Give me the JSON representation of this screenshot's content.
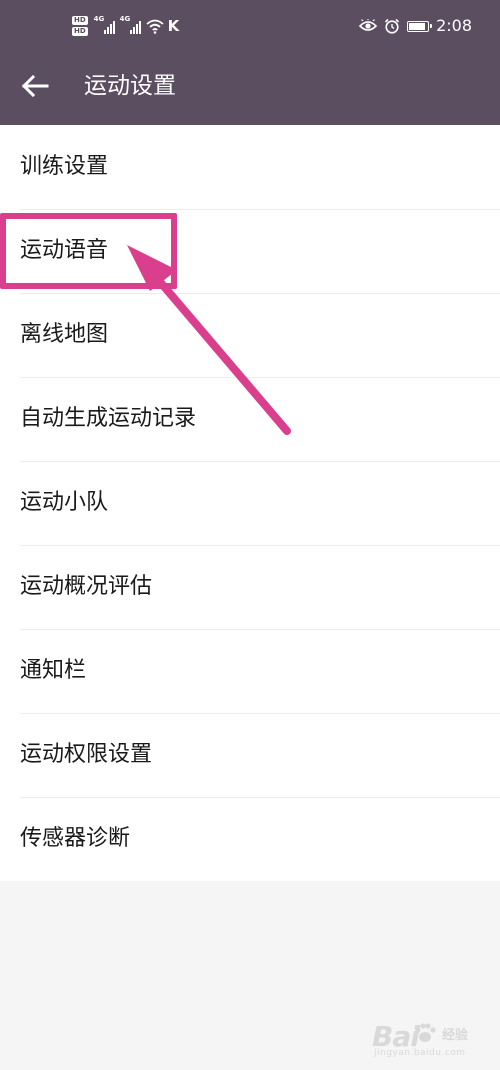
{
  "status_bar": {
    "hd_badges": [
      "HD",
      "HD"
    ],
    "network_labels": [
      "4G",
      "4G"
    ],
    "carrier_letter": "K",
    "time": "2:08",
    "icons": [
      "eye-icon",
      "alarm-icon",
      "battery-icon",
      "wifi-icon",
      "signal-icon"
    ]
  },
  "header": {
    "back_icon": "arrow-left-icon",
    "title": "运动设置"
  },
  "settings": {
    "items": [
      {
        "label": "训练设置"
      },
      {
        "label": "运动语音"
      },
      {
        "label": "离线地图"
      },
      {
        "label": "自动生成运动记录"
      },
      {
        "label": "运动小队"
      },
      {
        "label": "运动概况评估"
      },
      {
        "label": "通知栏"
      },
      {
        "label": "运动权限设置"
      },
      {
        "label": "传感器诊断"
      }
    ]
  },
  "annotation": {
    "highlighted_item": "运动语音",
    "color": "#d93f8c"
  },
  "watermark": {
    "main": "Bai",
    "sub": "经验",
    "url": "jingyan.baidu.com"
  },
  "colors": {
    "bar_background": "#5a4e60",
    "list_background": "#ffffff",
    "page_background": "#f5f5f5",
    "text": "#1a1a1a",
    "divider": "#ececec"
  }
}
